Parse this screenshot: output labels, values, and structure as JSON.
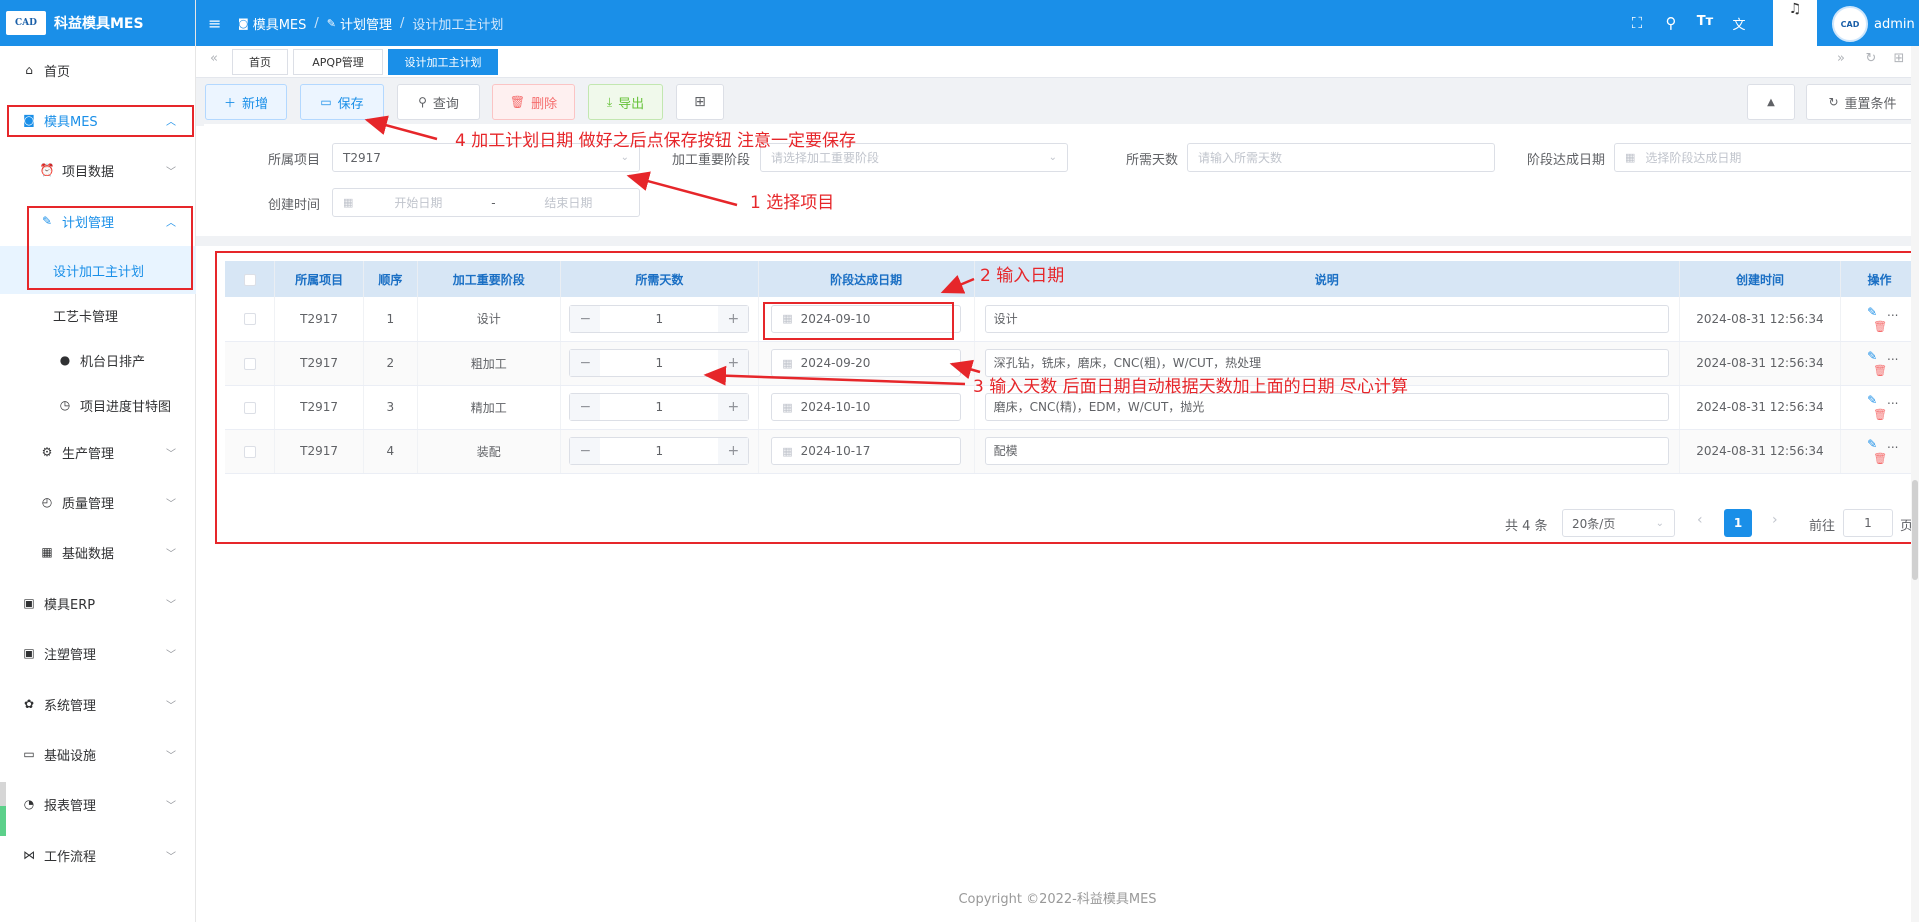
{
  "app": {
    "logo_text": "CAD",
    "title": "科益模具MES"
  },
  "sidebar": [
    {
      "label": "首页",
      "icon": "home-icon"
    },
    {
      "label": "模具MES",
      "icon": "camera-icon"
    },
    {
      "label": "项目数据",
      "icon": "alarm-icon"
    },
    {
      "label": "计划管理",
      "icon": "edit-icon"
    },
    {
      "label": "设计加工主计划",
      "icon": ""
    },
    {
      "label": "工艺卡管理",
      "icon": ""
    },
    {
      "label": "机台日排产",
      "icon": "user-icon"
    },
    {
      "label": "项目进度甘特图",
      "icon": "clock-icon"
    },
    {
      "label": "生产管理",
      "icon": "factory-icon"
    },
    {
      "label": "质量管理",
      "icon": "stopwatch-icon"
    },
    {
      "label": "基础数据",
      "icon": "calendar-grid-icon"
    },
    {
      "label": "模具ERP",
      "icon": "briefcase-icon"
    },
    {
      "label": "注塑管理",
      "icon": "briefcase-icon"
    },
    {
      "label": "系统管理",
      "icon": "gear-icon"
    },
    {
      "label": "基础设施",
      "icon": "monitor-icon"
    },
    {
      "label": "报表管理",
      "icon": "pie-chart-icon"
    },
    {
      "label": "工作流程",
      "icon": "workflow-icon"
    }
  ],
  "breadcrumb": [
    "模具MES",
    "计划管理",
    "设计加工主计划"
  ],
  "user": {
    "name": "admin"
  },
  "tabs": [
    "首页",
    "APQP管理",
    "设计加工主计划"
  ],
  "toolbar": {
    "add": "新增",
    "save": "保存",
    "query": "查询",
    "delete": "删除",
    "export": "导出",
    "reset": "重置条件"
  },
  "form": {
    "project_label": "所属项目",
    "project_value": "T2917",
    "stage_label": "加工重要阶段",
    "stage_placeholder": "请选择加工重要阶段",
    "days_label": "所需天数",
    "days_placeholder": "请输入所需天数",
    "date_label": "阶段达成日期",
    "date_placeholder": "选择阶段达成日期",
    "created_label": "创建时间",
    "start_placeholder": "开始日期",
    "range_sep": "-",
    "end_placeholder": "结束日期"
  },
  "table": {
    "headers": [
      "所属项目",
      "顺序",
      "加工重要阶段",
      "所需天数",
      "阶段达成日期",
      "说明",
      "创建时间",
      "操作"
    ],
    "rows": [
      {
        "project": "T2917",
        "order": "1",
        "stage": "设计",
        "days": "1",
        "date": "2024-09-10",
        "desc": "设计",
        "created": "2024-08-31 12:56:34"
      },
      {
        "project": "T2917",
        "order": "2",
        "stage": "粗加工",
        "days": "1",
        "date": "2024-09-20",
        "desc": "深孔钻，铣床，磨床，CNC(粗)，W/CUT，热处理",
        "created": "2024-08-31 12:56:34"
      },
      {
        "project": "T2917",
        "order": "3",
        "stage": "精加工",
        "days": "1",
        "date": "2024-10-10",
        "desc": "磨床，CNC(精)，EDM，W/CUT，抛光",
        "created": "2024-08-31 12:56:34"
      },
      {
        "project": "T2917",
        "order": "4",
        "stage": "装配",
        "days": "1",
        "date": "2024-10-17",
        "desc": "配模",
        "created": "2024-08-31 12:56:34"
      }
    ],
    "op_more": "..."
  },
  "pagination": {
    "total": "共 4 条",
    "page_size": "20条/页",
    "current": "1",
    "goto_label": "前往",
    "goto_value": "1",
    "page_suffix": "页"
  },
  "annotations": {
    "a1": "1 选择项目",
    "a2": "2 输入日期",
    "a3": "3 输入天数 后面日期自动根据天数加上面的日期 尽心计算",
    "a4": "4 加工计划日期 做好之后点保存按钮 注意一定要保存"
  },
  "footer": "Copyright ©2022-科益模具MES",
  "colors": {
    "primary": "#1a8fe8",
    "annotation": "#e6262a",
    "header_bg": "#d7e6f5"
  }
}
